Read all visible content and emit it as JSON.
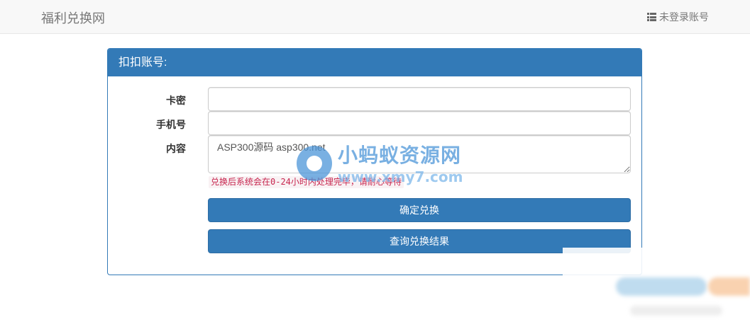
{
  "navbar": {
    "brand": "福利兑换网",
    "account_icon": "list-icon",
    "account_label": "未登录账号"
  },
  "panel": {
    "heading": "扣扣账号:",
    "fields": {
      "card_label": "卡密",
      "card_value": "",
      "phone_label": "手机号",
      "phone_value": "",
      "content_label": "内容",
      "content_value": "ASP300源码 asp300.net"
    },
    "help_text": "兑换后系统会在0-24小时内处理完毕，请耐心等待",
    "confirm_button": "确定兑换",
    "query_button": "查询兑换结果"
  },
  "watermark": {
    "name": "小蚂蚁资源网",
    "url": "www.xmy7.com"
  },
  "colors": {
    "primary": "#337ab7",
    "primary_border": "#2e6da4",
    "navbar_bg": "#f8f8f8",
    "help_text": "#c7254e",
    "help_bg": "#f9f2f4",
    "watermark": "#4d96d9"
  }
}
